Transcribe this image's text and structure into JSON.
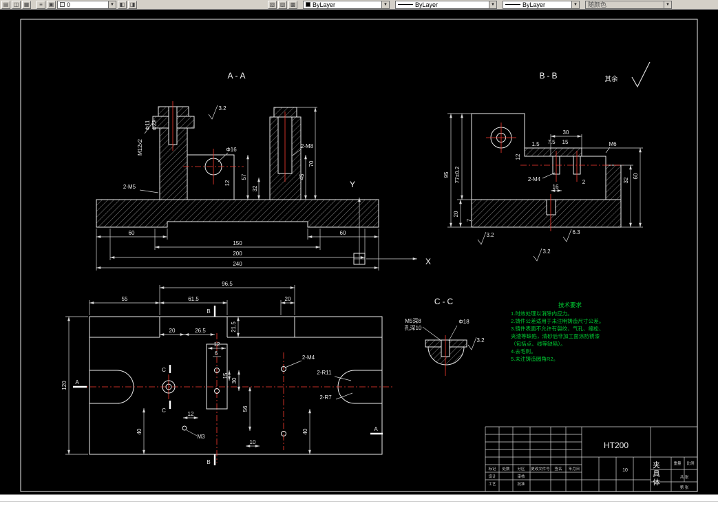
{
  "toolbar": {
    "layer": "0",
    "color": "ByLayer",
    "linetype": "ByLayer",
    "lineweight": "ByLayer",
    "plotstyle": "随颜色"
  },
  "axes": {
    "x": "X",
    "y": "Y"
  },
  "view_aa": {
    "title": "A-A",
    "labels": [
      "M12x2",
      "Φ11",
      "Φ22",
      "Φ16",
      "2-M8",
      "2-M5",
      "70",
      "45",
      "57",
      "32",
      "12",
      "60",
      "150",
      "200",
      "240",
      "60",
      "3.2"
    ]
  },
  "view_bb": {
    "title": "B-B",
    "rest_note": "其余",
    "labels": [
      "95",
      "77±0.2",
      "30",
      "7.5",
      "15",
      "1.5",
      "12",
      "2-M4",
      "16",
      "2",
      "M6",
      "32",
      "60",
      "20",
      "7",
      "3.2",
      "6.3",
      "3.2"
    ]
  },
  "view_cc": {
    "title": "C-C",
    "labels": [
      "M5深8",
      "孔深10",
      "Φ18",
      "3.2"
    ]
  },
  "view_plan": {
    "labels": [
      "96.5",
      "55",
      "61.5",
      "20",
      "120",
      "20",
      "26.5",
      "21.5",
      "12",
      "6",
      "15",
      "30",
      "56",
      "40",
      "12",
      "10",
      "40",
      "2-M4",
      "2-R11",
      "2-R7",
      "M3"
    ],
    "marks": [
      "B",
      "B",
      "A",
      "A",
      "C",
      "C"
    ]
  },
  "notes": {
    "title": "技术要求",
    "lines": [
      "1.时效处理以消除内应力。",
      "2.铸件公差适用于未注明铸造尺寸公差。",
      "3.铸件表面不允许有裂纹、气孔、缩松、",
      "  夹渣等缺陷，清砂后非加工面涂防锈漆",
      " （包括点、线等缺陷）。",
      "4.去毛刺。",
      "5.未注铸造圆角R2。"
    ]
  },
  "title_block": {
    "material": "HT200",
    "part_name": "夹具体",
    "sheet_no": "10",
    "row_labels": [
      "标记",
      "处数",
      "分区",
      "更改文件号",
      "签名",
      "年月日"
    ],
    "col_labels": [
      "设计",
      "审核",
      "工艺",
      "批准"
    ],
    "right_labels": [
      "重量",
      "比例",
      "共 张",
      "第 张"
    ]
  }
}
